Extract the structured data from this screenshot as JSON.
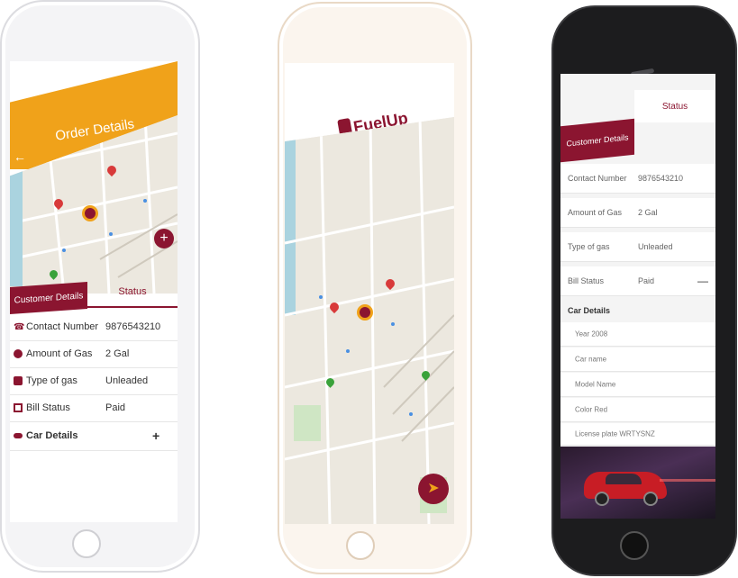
{
  "left_phone": {
    "header_title": "Order Details",
    "back_icon": "arrow-left-icon",
    "fab_icon": "plus-icon",
    "tabs": [
      {
        "label": "Customer Details",
        "active": true
      },
      {
        "label": "Status",
        "active": false
      }
    ],
    "rows": [
      {
        "label": "Contact Number",
        "value": "9876543210",
        "icon": "phone-icon"
      },
      {
        "label": "Amount of Gas",
        "value": "2 Gal",
        "icon": "gas-drop-icon"
      },
      {
        "label": "Type of gas",
        "value": "Unleaded",
        "icon": "fuel-pump-icon"
      },
      {
        "label": "Bill Status",
        "value": "Paid",
        "icon": "bill-icon"
      }
    ],
    "car_details_label": "Car Details",
    "car_details_toggle": "+",
    "colors": {
      "header": "#f0a21a",
      "accent": "#8b1530"
    }
  },
  "middle_phone": {
    "logo_text": "FuelUp",
    "fab_icon": "navigate-arrow-icon",
    "colors": {
      "accent": "#8b1530"
    }
  },
  "right_phone": {
    "tabs": [
      {
        "label": "Customer Details",
        "active": true
      },
      {
        "label": "Status",
        "active": false
      }
    ],
    "rows": [
      {
        "label": "Contact Number",
        "value": "9876543210"
      },
      {
        "label": "Amount of Gas",
        "value": "2 Gal"
      },
      {
        "label": "Type of gas",
        "value": "Unleaded"
      },
      {
        "label": "Bill Status",
        "value": "Paid"
      }
    ],
    "bill_toggle": "—",
    "car_details_title": "Car Details",
    "car_rows": [
      "Year 2008",
      "Car name",
      "Model Name",
      "Color Red",
      "License plate WRTYSNZ"
    ],
    "colors": {
      "accent": "#8b1530"
    }
  }
}
